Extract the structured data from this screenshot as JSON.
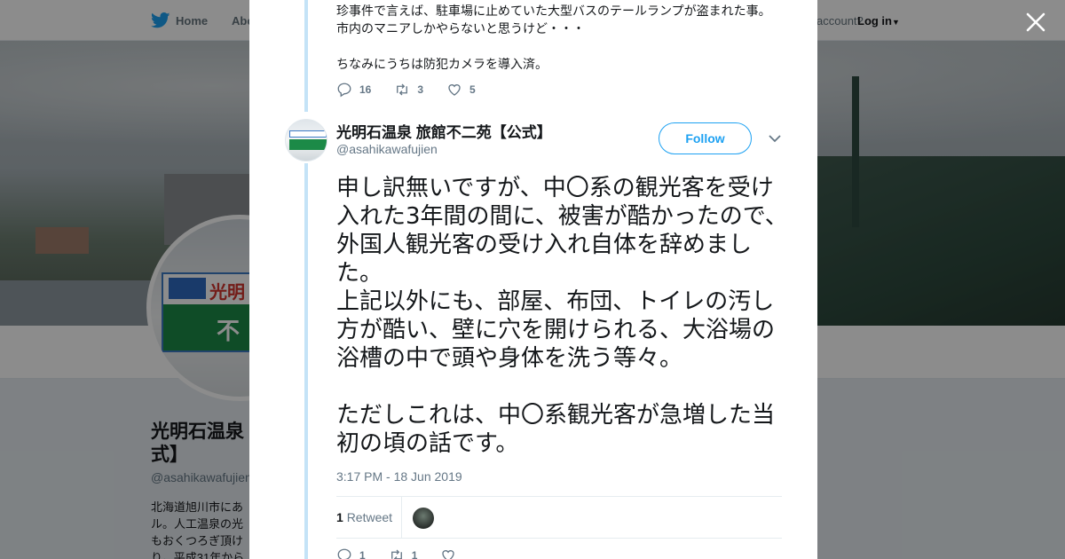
{
  "topnav": {
    "home_label": "Home",
    "about_label": "Abo",
    "login_prompt": "account?",
    "login_label": "Log in"
  },
  "profile": {
    "name": "光明石温泉\n式】",
    "handle": "@asahikawafujien",
    "bio": "北海道旭川市にあ\nル。人工温泉の光\nもおくつろぎ頂け\nり。平成31年から"
  },
  "prev_tweet": {
    "text": "珍事件で言えば、駐車場に止めていた大型バスのテールランプが盗まれた事。\n市内のマニアしかやらないと思うけど・・・\n\nちなみにうちは防犯カメラを導入済。",
    "replies": "16",
    "retweets": "3",
    "likes": "5"
  },
  "tweet": {
    "name": "光明石温泉 旅館不二苑【公式】",
    "handle": "@asahikawafujien",
    "follow_label": "Follow",
    "body": "申し訳無いですが、中〇系の観光客を受け入れた3年間の間に、被害が酷かったので、外国人観光客の受け入れ自体を辞めました。\n上記以外にも、部屋、布団、トイレの汚し方が酷い、壁に穴を開けられる、大浴場の浴槽の中で頭や身体を洗う等々。\n\nただしこれは、中〇系観光客が急増した当初の頃の話です。",
    "timestamp": "3:17 PM - 18 Jun 2019",
    "retweet_count": "1",
    "retweet_label": "Retweet",
    "replies": "1",
    "retweets": "1"
  },
  "colors": {
    "accent": "#1da1f2",
    "thread_line": "#c4e3f7",
    "muted": "#657786"
  },
  "icons": {
    "twitter": "twitter-bird-icon",
    "close": "close-icon",
    "reply": "reply-icon",
    "retweet": "retweet-icon",
    "like": "heart-icon",
    "caret": "chevron-down-icon"
  }
}
